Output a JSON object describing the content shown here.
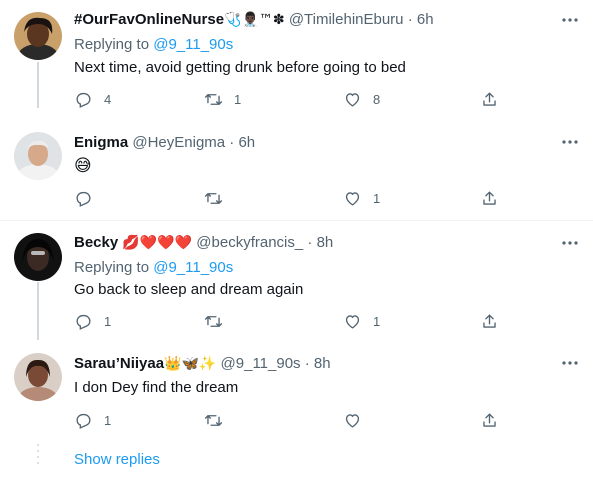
{
  "colors": {
    "accent": "#1d9bf0",
    "muted": "#536471",
    "text": "#0f1419",
    "line": "#cfd9de",
    "heart": "#e0245e"
  },
  "tweets": [
    {
      "name": "#OurFavOnlineNurse",
      "name_emojis": "🩺👨🏿‍⚕️™✽",
      "handle": "@TimilehinEburu",
      "dot": "·",
      "time": "6h",
      "replying_prefix": "Replying to",
      "replying_mention": "@9_11_90s",
      "text": "Next time, avoid getting drunk before going to bed",
      "replies": "4",
      "retweets": "1",
      "likes": "8"
    },
    {
      "name": "Enigma",
      "handle": "@HeyEnigma",
      "dot": "·",
      "time": "6h",
      "text": "😅",
      "replies": "",
      "retweets": "",
      "likes": "1"
    },
    {
      "name": "Becky",
      "name_emojis": "💋❤️❤️❤️",
      "handle": "@beckyfrancis_",
      "dot": "·",
      "time": "8h",
      "replying_prefix": "Replying to",
      "replying_mention": "@9_11_90s",
      "text": "Go back to sleep and dream again",
      "replies": "1",
      "retweets": "",
      "likes": "1"
    },
    {
      "name": "Sarau’Niiyaa",
      "name_emojis": "👑🦋✨",
      "handle": "@9_11_90s",
      "dot": "·",
      "time": "8h",
      "text": "I don Dey find the dream",
      "replies": "1",
      "retweets": "",
      "likes": ""
    }
  ],
  "show_replies": "Show replies",
  "icons": {
    "more": "more-horizontal-icon",
    "reply": "reply-icon",
    "retweet": "retweet-icon",
    "like": "heart-icon",
    "share": "share-icon"
  }
}
